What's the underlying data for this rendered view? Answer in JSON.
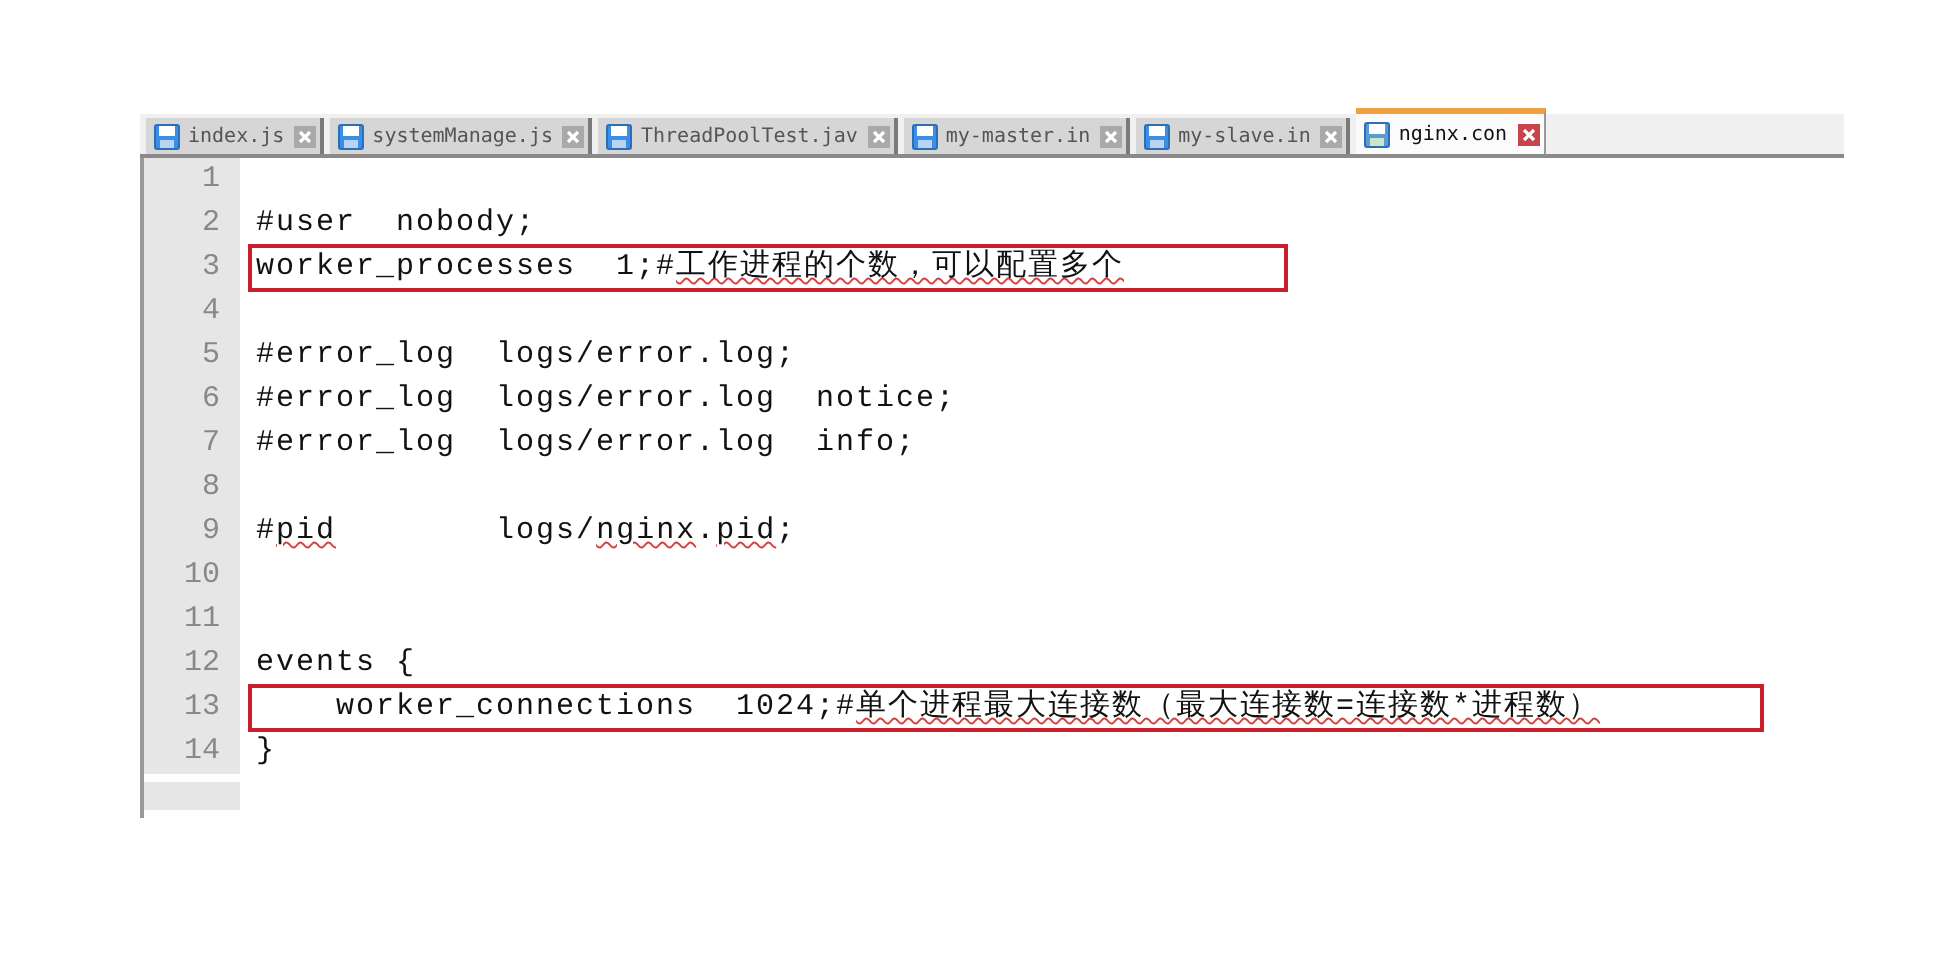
{
  "tabs": [
    {
      "label": "index.js",
      "selected": false
    },
    {
      "label": "systemManage.js",
      "selected": false
    },
    {
      "label": "ThreadPoolTest.jav",
      "selected": false
    },
    {
      "label": "my-master.in",
      "selected": false
    },
    {
      "label": "my-slave.in",
      "selected": false
    },
    {
      "label": "nginx.con",
      "selected": true
    }
  ],
  "lines": [
    {
      "number": "1"
    },
    {
      "number": "2",
      "boxed": false,
      "segments": [
        {
          "text": "#user  nobody;",
          "misspelled": false
        }
      ]
    },
    {
      "number": "3",
      "boxed": true,
      "segments": [
        {
          "text": "worker_processes  1;#",
          "misspelled": false
        },
        {
          "text": "工作进程的个数，可以配置多个",
          "misspelled": true
        }
      ]
    },
    {
      "number": "4"
    },
    {
      "number": "5",
      "boxed": false,
      "segments": [
        {
          "text": "#error_log  logs/error.log;",
          "misspelled": false
        }
      ]
    },
    {
      "number": "6",
      "boxed": false,
      "segments": [
        {
          "text": "#error_log  logs/error.log  notice;",
          "misspelled": false
        }
      ]
    },
    {
      "number": "7",
      "boxed": false,
      "segments": [
        {
          "text": "#error_log  logs/error.log  info;",
          "misspelled": false
        }
      ]
    },
    {
      "number": "8"
    },
    {
      "number": "9",
      "boxed": false,
      "segments": [
        {
          "text": "#",
          "misspelled": false
        },
        {
          "text": "pid",
          "misspelled": true
        },
        {
          "text": "        logs/",
          "misspelled": false
        },
        {
          "text": "nginx",
          "misspelled": true
        },
        {
          "text": ".",
          "misspelled": false
        },
        {
          "text": "pid",
          "misspelled": true
        },
        {
          "text": ";",
          "misspelled": false
        }
      ]
    },
    {
      "number": "10"
    },
    {
      "number": "11"
    },
    {
      "number": "12",
      "boxed": false,
      "segments": [
        {
          "text": "events {",
          "misspelled": false
        }
      ]
    },
    {
      "number": "13",
      "boxed": true,
      "segments": [
        {
          "text": "    worker_connections  1024;#",
          "misspelled": false
        },
        {
          "text": "单个进程最大连接数（最大连接数=连接数*进程数）",
          "misspelled": true
        }
      ]
    },
    {
      "number": "14",
      "boxed": false,
      "segments": [
        {
          "text": "}",
          "misspelled": false
        }
      ]
    }
  ]
}
